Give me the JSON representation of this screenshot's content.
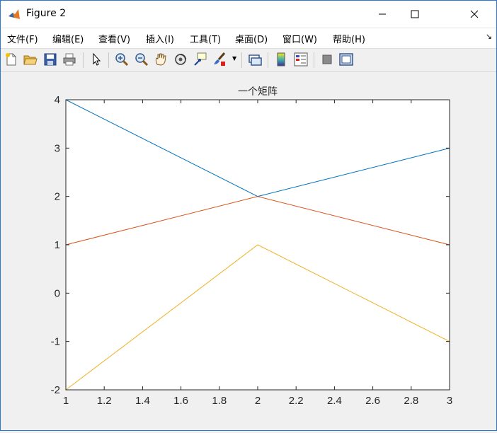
{
  "window": {
    "title": "Figure 2"
  },
  "menu": {
    "items": [
      "文件(F)",
      "编辑(E)",
      "查看(V)",
      "插入(I)",
      "工具(T)",
      "桌面(D)",
      "窗口(W)",
      "帮助(H)"
    ]
  },
  "toolbar": {
    "icons": [
      "new-figure-icon",
      "open-icon",
      "save-icon",
      "print-icon",
      "pointer-icon",
      "zoom-in-icon",
      "zoom-out-icon",
      "pan-icon",
      "rotate-icon",
      "data-cursor-icon",
      "brush-icon",
      "link-plot-icon",
      "colorbar-icon",
      "legend-icon",
      "hide-plot-tools-icon",
      "show-plot-tools-icon"
    ]
  },
  "colors": {
    "series1": "#0072BD",
    "series2": "#D95319",
    "series3": "#EDB120"
  },
  "chart_data": {
    "type": "line",
    "title": "一个矩阵",
    "xlabel": "",
    "ylabel": "",
    "xlim": [
      1,
      3
    ],
    "ylim": [
      -2,
      4
    ],
    "x": [
      1,
      2,
      3
    ],
    "xticks": [
      "1",
      "1.2",
      "1.4",
      "1.6",
      "1.8",
      "2",
      "2.2",
      "2.4",
      "2.6",
      "2.8",
      "3"
    ],
    "yticks": [
      "-2",
      "-1",
      "0",
      "1",
      "2",
      "3",
      "4"
    ],
    "grid": false,
    "series": [
      {
        "values": [
          4,
          2,
          3
        ]
      },
      {
        "values": [
          1,
          2,
          1
        ]
      },
      {
        "values": [
          -2,
          1,
          -1
        ]
      }
    ]
  }
}
